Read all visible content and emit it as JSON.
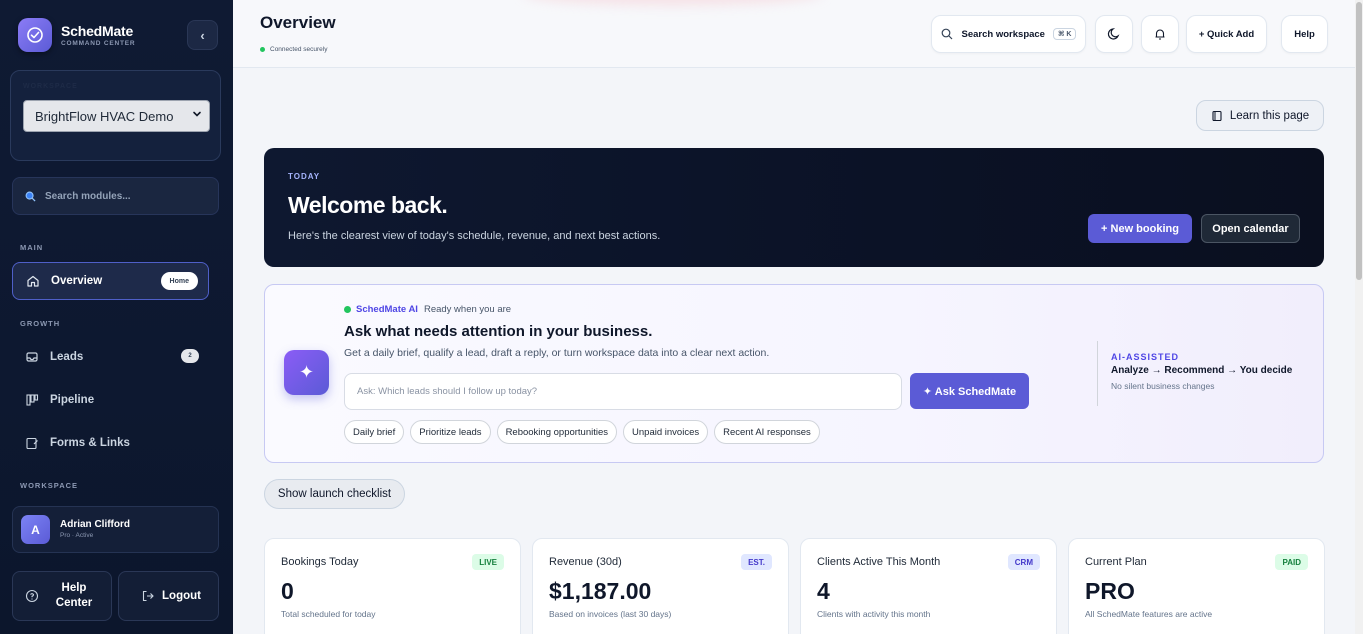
{
  "brand": {
    "name": "SchedMate",
    "subtitle": "COMMAND CENTER"
  },
  "workspace": {
    "label": "WORKSPACE",
    "selected": "BrightFlow HVAC Demo"
  },
  "module_search": {
    "placeholder": "Search modules..."
  },
  "nav": {
    "main_label": "MAIN",
    "overview": {
      "label": "Overview",
      "pill": "Home"
    },
    "growth_label": "GROWTH",
    "leads": {
      "label": "Leads",
      "count": "2"
    },
    "pipeline": {
      "label": "Pipeline"
    },
    "forms": {
      "label": "Forms & Links"
    },
    "workspace_label": "WORKSPACE"
  },
  "user": {
    "initial": "A",
    "name": "Adrian Clifford",
    "role": "Pro · Active"
  },
  "sidebar_buttons": {
    "help": "Help Center",
    "logout": "Logout"
  },
  "header": {
    "title": "Overview",
    "status": "Connected securely",
    "search_label": "Search workspace",
    "search_shortcut": "⌘ K",
    "quick_add": "+ Quick Add",
    "help": "Help"
  },
  "learn": {
    "label": "Learn this page"
  },
  "hero": {
    "tag": "TODAY",
    "title": "Welcome back.",
    "subtitle": "Here's the clearest view of today's schedule, revenue, and next best actions.",
    "new_booking": "+ New booking",
    "open_calendar": "Open calendar"
  },
  "ai": {
    "brand": "SchedMate AI",
    "status": "Ready when you are",
    "title": "Ask what needs attention in your business.",
    "subtitle": "Get a daily brief, qualify a lead, draft a reply, or turn workspace data into a clear next action.",
    "input_placeholder": "Ask: Which leads should I follow up today?",
    "ask_button": "✦ Ask SchedMate",
    "chips": [
      "Daily brief",
      "Prioritize leads",
      "Rebooking opportunities",
      "Unpaid invoices",
      "Recent AI responses"
    ],
    "side_tag": "AI-ASSISTED",
    "side_flow": "Analyze → Recommend → You decide",
    "side_note": "No silent business changes"
  },
  "checklist": {
    "label": "Show launch checklist"
  },
  "stats": [
    {
      "label": "Bookings Today",
      "badge": "LIVE",
      "value": "0",
      "desc": "Total scheduled for today",
      "badge_bg": "#dcfce7",
      "badge_fg": "#15803d"
    },
    {
      "label": "Revenue (30d)",
      "badge": "EST.",
      "value": "$1,187.00",
      "desc": "Based on invoices (last 30 days)",
      "badge_bg": "#e0e7ff",
      "badge_fg": "#4338ca"
    },
    {
      "label": "Clients Active This Month",
      "badge": "CRM",
      "value": "4",
      "desc": "Clients with activity this month",
      "badge_bg": "#e0e7ff",
      "badge_fg": "#4338ca"
    },
    {
      "label": "Current Plan",
      "badge": "PAID",
      "value": "PRO",
      "desc": "All SchedMate features are active",
      "badge_bg": "#dcfce7",
      "badge_fg": "#15803d"
    }
  ],
  "colors": {
    "accent": "#5b5bd6",
    "sidebar": "#0f1a33",
    "success": "#22c55e"
  }
}
